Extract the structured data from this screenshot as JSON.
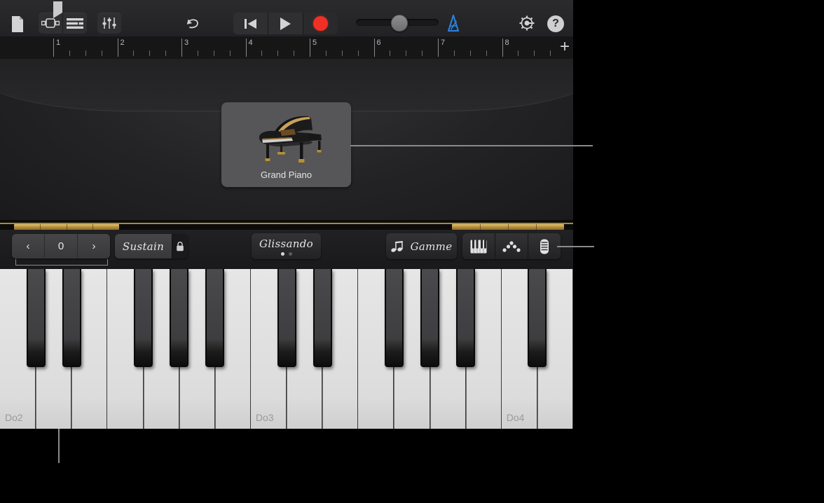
{
  "toolbar": {
    "document_label": "My Songs",
    "view_track_label": "Track View",
    "view_list_label": "List View",
    "mixer_label": "Track Controls",
    "undo_label": "Undo",
    "rewind_label": "Go to Beginning",
    "play_label": "Play",
    "record_label": "Record",
    "master_volume_label": "Master Volume",
    "master_volume_value": "42",
    "metronome_label": "Metronome",
    "metronome_active": "true",
    "settings_label": "Song Settings",
    "help_label": "?",
    "metronome_color": "#2b84e8",
    "record_color": "#f03024"
  },
  "ruler": {
    "bars": [
      "1",
      "2",
      "3",
      "4",
      "5",
      "6",
      "7",
      "8"
    ],
    "add_track_label": "+",
    "playhead_position": "1"
  },
  "stage": {
    "instrument_name": "Grand Piano"
  },
  "controls": {
    "octave_down_label": "‹",
    "octave_value": "0",
    "octave_up_label": "›",
    "sustain_label": "Sustain",
    "sustain_lock_label": "Lock Sustain",
    "glissando_label": "Glissando",
    "glissando_page": "1",
    "glissando_pages": "2",
    "gamme_label": "Gamme",
    "keyboard_view_label": "Keyboard",
    "arpeggiator_label": "Arpeggiator",
    "ribbon_label": "Keyboard Layout"
  },
  "keyboard": {
    "octave_labels": [
      "Do2",
      "Do3",
      "Do4"
    ],
    "white_key_count": "16",
    "label_positions": [
      0,
      7,
      14
    ]
  }
}
